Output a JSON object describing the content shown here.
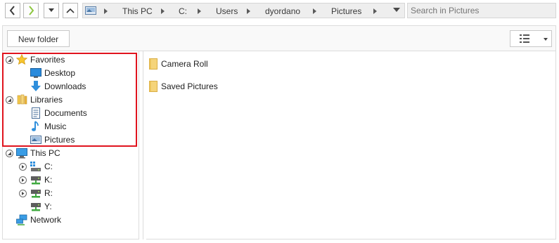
{
  "address": {
    "crumbs": [
      "This PC",
      "C:",
      "Users",
      "dyordano",
      "Pictures"
    ]
  },
  "search": {
    "placeholder": "Search in Pictures"
  },
  "toolbar": {
    "new_folder_label": "New folder"
  },
  "tree": {
    "favorites": {
      "label": "Favorites",
      "items": [
        "Desktop",
        "Downloads"
      ]
    },
    "libraries": {
      "label": "Libraries",
      "items": [
        "Documents",
        "Music",
        "Pictures"
      ]
    },
    "this_pc": {
      "label": "This PC",
      "drives": [
        "C:",
        "K:",
        "R:",
        "Y:"
      ]
    },
    "network": {
      "label": "Network"
    }
  },
  "files": [
    "Camera Roll",
    "Saved Pictures"
  ],
  "colors": {
    "highlight": "#e0141e",
    "folder": "#f5d47a",
    "accent": "#2f8fdc"
  }
}
